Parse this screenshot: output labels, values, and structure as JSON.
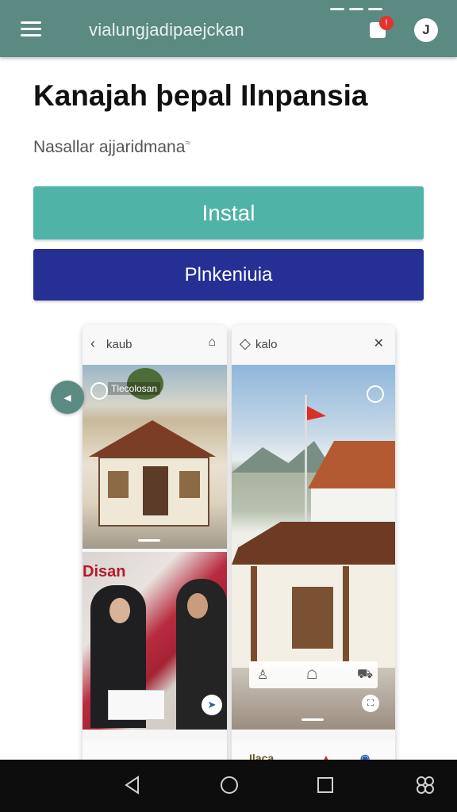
{
  "app_bar": {
    "title": "vialungjadipaejckan",
    "notification_count": "!",
    "info_glyph": "J",
    "color": "#5b8a83"
  },
  "main": {
    "title": "Kanajah þepal Ilnpansia",
    "subtitle": "Nasallar ajjaridmana",
    "subtitle_mark": "≈",
    "install_button": "Instal",
    "secondary_button": "Plnkeniuia",
    "install_color": "#4fb3a8",
    "secondary_color": "#262f94"
  },
  "screenshots": {
    "left": {
      "header_label": "kaub",
      "photo_tag": "Tlecolosan",
      "banner_text": "Disan"
    },
    "right": {
      "header_label": "kalo"
    },
    "footer_text": "Ilaca"
  },
  "icons": {
    "menu": "menu-icon",
    "notification": "notification-icon",
    "info": "info-icon",
    "scroll_left": "arrow-left-icon",
    "back": "triangle-back-icon",
    "home": "circle-home-icon",
    "recents": "square-recents-icon",
    "extra": "grid-icon"
  }
}
